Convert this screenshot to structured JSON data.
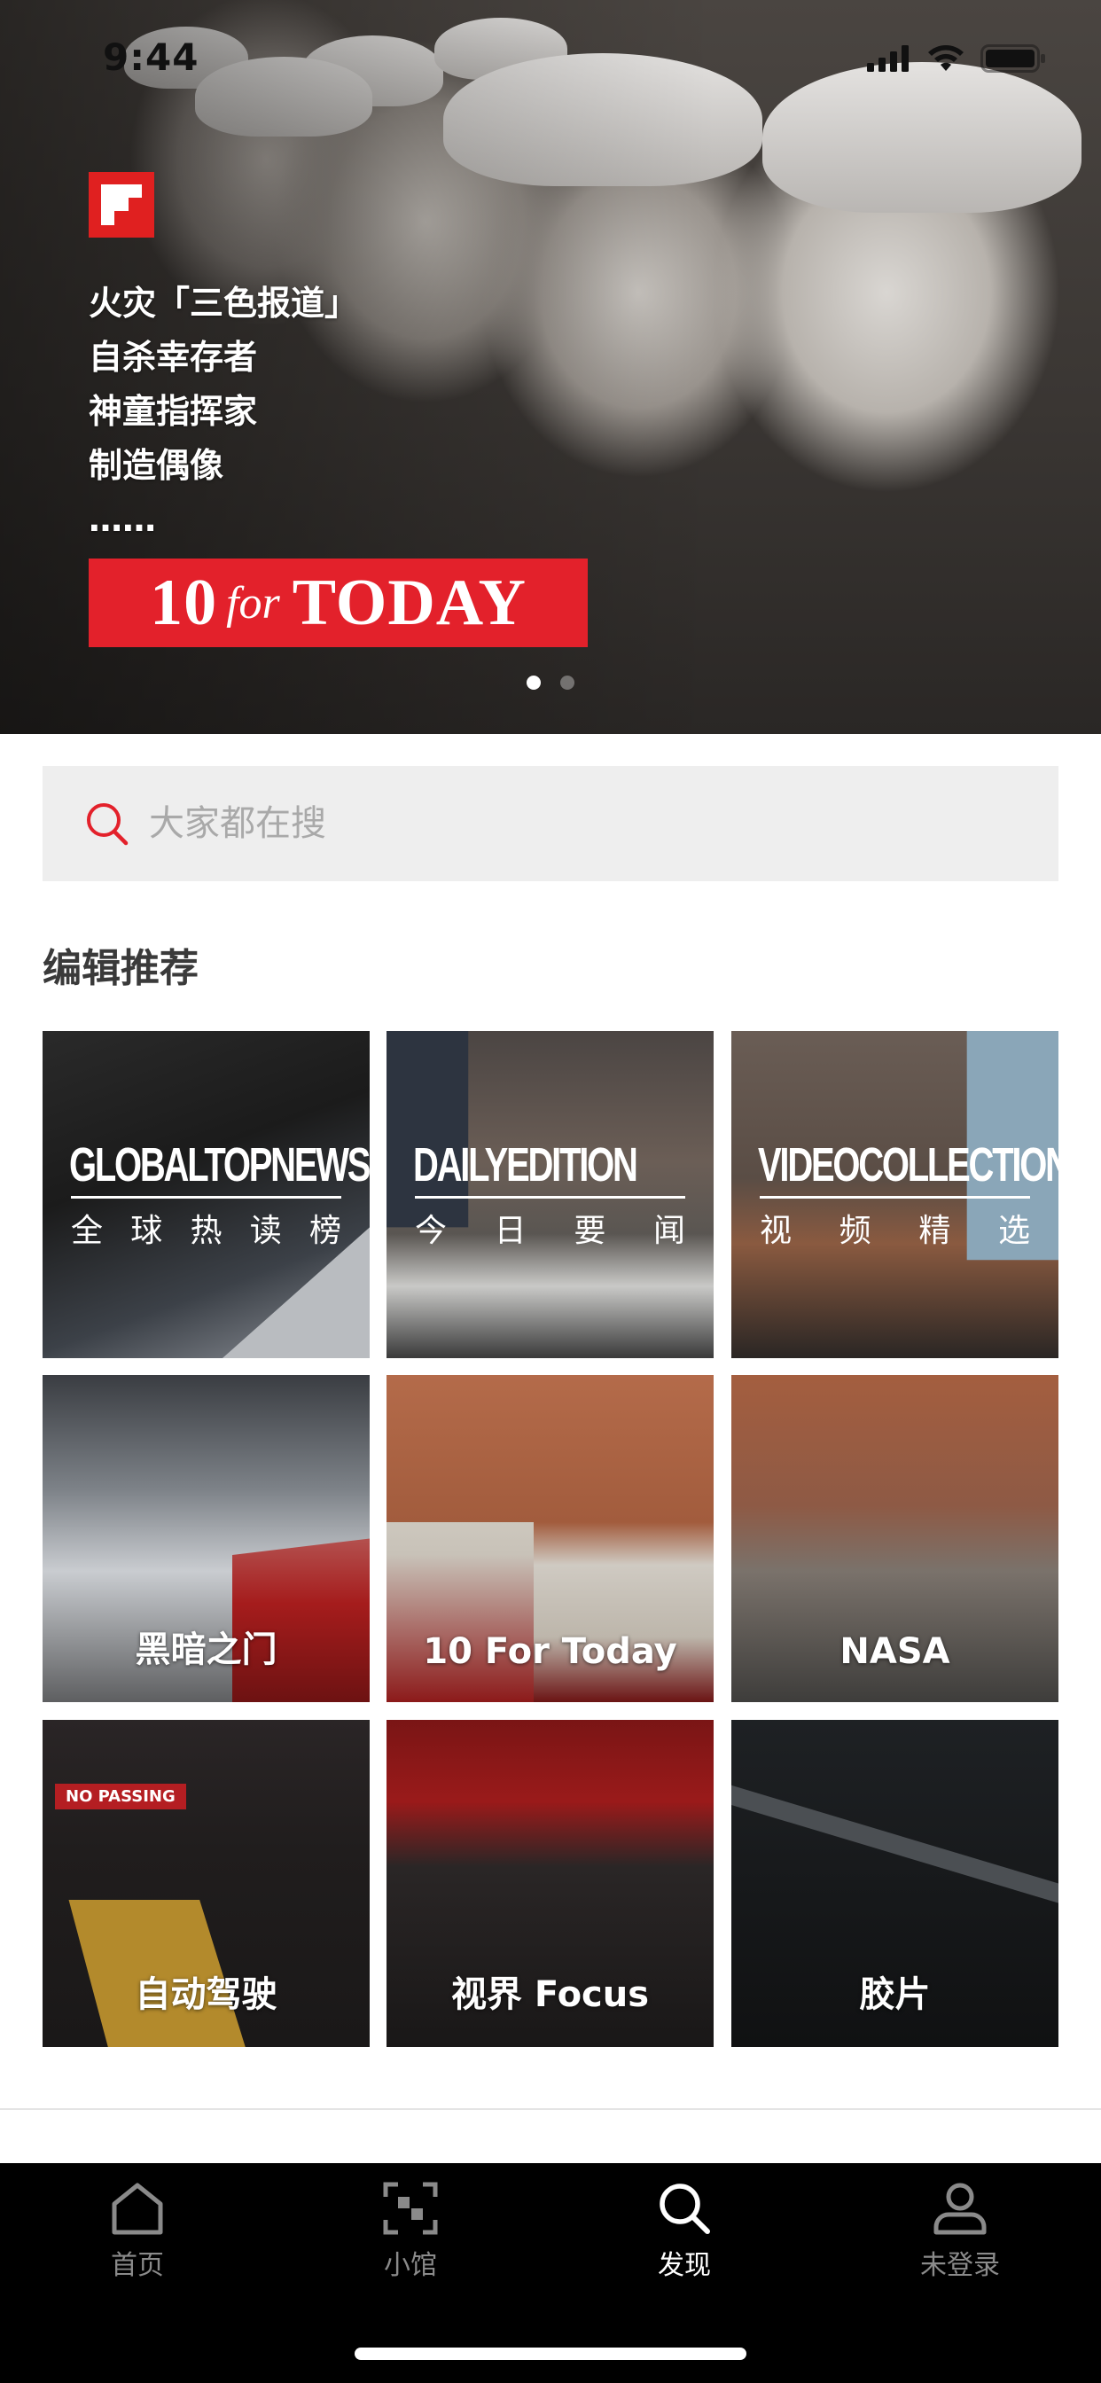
{
  "status_bar": {
    "time": "9:44"
  },
  "hero": {
    "lines": [
      "火灾「三色报道」",
      "自杀幸存者",
      "神童指挥家",
      "制造偶像",
      "……"
    ],
    "badge": {
      "number": "10",
      "for": "for",
      "word": "TODAY"
    },
    "page_count": 2,
    "active_page": 0
  },
  "search": {
    "placeholder": "大家都在搜"
  },
  "editor_picks": {
    "title": "编辑推荐",
    "tiles": [
      {
        "en": "GLOBALTOPNEWS",
        "cn": [
          "全",
          "球",
          "热",
          "读",
          "榜"
        ]
      },
      {
        "en": "DAILYEDITION",
        "cn": [
          "今",
          "日",
          "要",
          "闻"
        ]
      },
      {
        "en": "VIDEOCOLLECTION",
        "cn": [
          "视",
          "频",
          "精",
          "选"
        ]
      },
      {
        "label": "黑暗之门"
      },
      {
        "label": "10 For Today"
      },
      {
        "label": "NASA"
      },
      {
        "label": "自动驾驶",
        "sign": "NO PASSING"
      },
      {
        "label": "视界 Focus"
      },
      {
        "label": "胶片"
      }
    ]
  },
  "tabbar": {
    "items": [
      {
        "label": "首页",
        "icon": "home-icon"
      },
      {
        "label": "小馆",
        "icon": "frame-icon"
      },
      {
        "label": "发现",
        "icon": "search-icon"
      },
      {
        "label": "未登录",
        "icon": "person-icon"
      }
    ],
    "active": 2
  },
  "colors": {
    "brand_red": "#e3212b",
    "search_bg": "#eeeeee",
    "tab_bg": "#000000"
  }
}
